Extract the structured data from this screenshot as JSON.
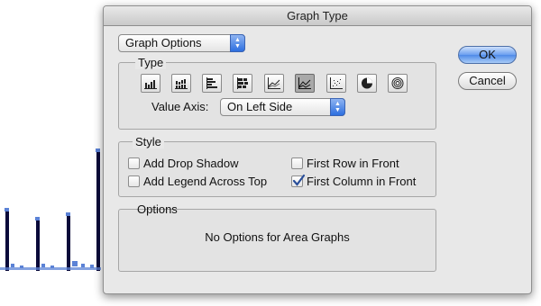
{
  "dialog": {
    "title": "Graph Type"
  },
  "graph_options_popup": {
    "value": "Graph Options"
  },
  "type_group": {
    "label": "Type",
    "icons": [
      "grouped-column-graph-icon",
      "stacked-column-graph-icon",
      "bar-graph-icon",
      "stacked-bar-graph-icon",
      "line-graph-icon",
      "area-graph-icon",
      "scatter-graph-icon",
      "pie-graph-icon",
      "radar-graph-icon"
    ],
    "selected_icon": "area-graph-icon",
    "value_axis_label": "Value Axis:",
    "value_axis_value": "On Left Side"
  },
  "style_group": {
    "label": "Style",
    "add_drop_shadow": {
      "label": "Add Drop Shadow",
      "checked": false
    },
    "add_legend_across_top": {
      "label": "Add Legend Across Top",
      "checked": false
    },
    "first_row_in_front": {
      "label": "First Row in Front",
      "checked": false
    },
    "first_column_in_front": {
      "label": "First Column in Front",
      "checked": true
    }
  },
  "options_group": {
    "label": "Options",
    "message": "No Options for Area Graphs"
  },
  "buttons": {
    "ok": "OK",
    "cancel": "Cancel"
  },
  "colors": {
    "accent": "#4f8be8",
    "background_graph": "#0a0a3a",
    "graph_handles": "#5b82d6"
  }
}
